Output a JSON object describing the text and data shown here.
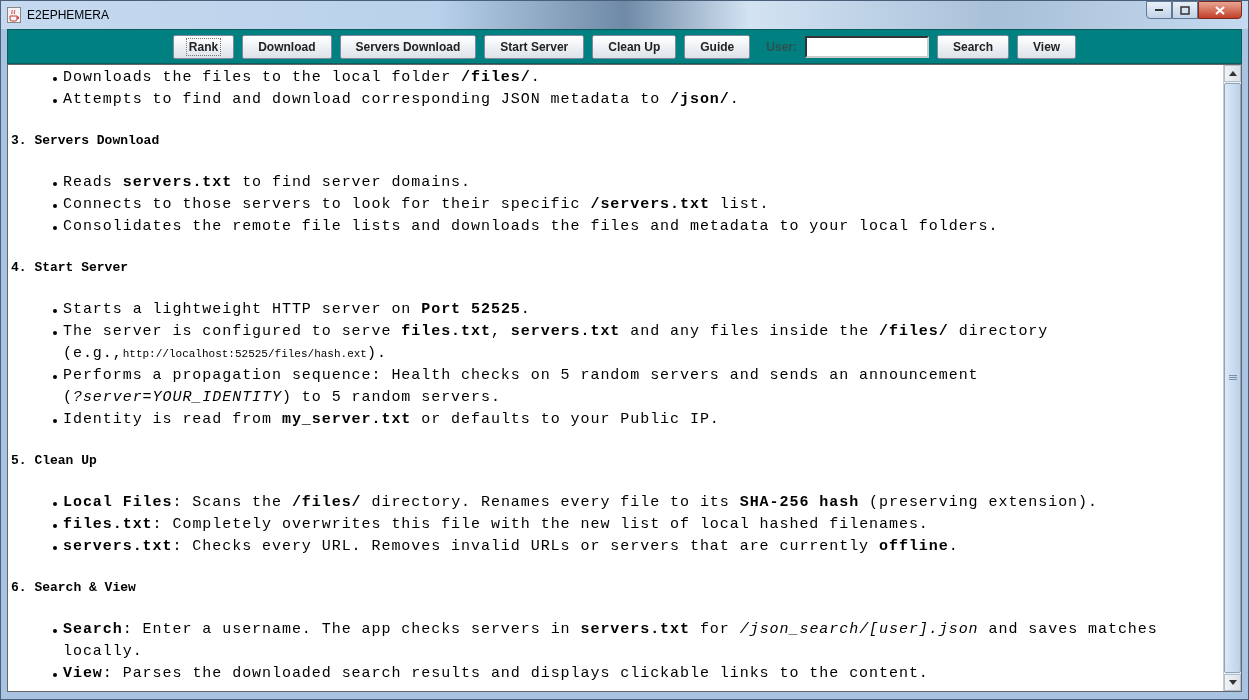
{
  "window": {
    "title": "E2EPHEMERA"
  },
  "toolbar": {
    "buttons_left": [
      {
        "label": "Rank",
        "focused": true
      },
      {
        "label": "Download",
        "focused": false
      },
      {
        "label": "Servers Download",
        "focused": false
      },
      {
        "label": "Start Server",
        "focused": false
      },
      {
        "label": "Clean Up",
        "focused": false
      },
      {
        "label": "Guide",
        "focused": false
      }
    ],
    "user_label": "User:",
    "buttons_right": [
      {
        "label": "Search",
        "focused": false
      },
      {
        "label": "View",
        "focused": false
      }
    ]
  },
  "sections": [
    {
      "items": [
        {
          "text": "Downloads the files to the local folder **/files/**."
        },
        {
          "text": "Attempts to find and download corresponding JSON metadata to **/json/**."
        }
      ]
    },
    {
      "heading": "3. Servers Download",
      "items": [
        {
          "text": "Reads **servers.txt** to find server domains."
        },
        {
          "text": "Connects to those servers to look for their specific **/servers.txt** list."
        },
        {
          "text": "Consolidates the remote file lists and downloads the files and metadata to your local folders."
        }
      ]
    },
    {
      "heading": "4. Start Server",
      "items": [
        {
          "text": "Starts a lightweight HTTP server on **Port 52525**."
        },
        {
          "text": "The server is configured to serve **files.txt**, **servers.txt** and any files inside the **/files/** directory (e.g.,",
          "small": "http://localhost:52525/files/hash.ext",
          "after": ")."
        },
        {
          "lines": [
            "Performs a propagation sequence: Health checks on 5 random servers and sends an announcement",
            "(*?server=YOUR_IDENTITY*) to 5 random servers."
          ]
        },
        {
          "text": "Identity is read from **my_server.txt** or defaults to your Public IP."
        }
      ]
    },
    {
      "heading": "5. Clean Up",
      "items": [
        {
          "text": "**Local Files**: Scans the **/files/** directory. Renames every file to its **SHA-256 hash** (preserving extension)."
        },
        {
          "text": "**files.txt**: Completely overwrites this file with the new list of local hashed filenames."
        },
        {
          "text": "**servers.txt**: Checks every URL. Removes invalid URLs or servers that are currently **offline**."
        }
      ]
    },
    {
      "heading": "6. Search & View",
      "items": [
        {
          "text": "**Search**: Enter a username. The app checks servers in **servers.txt** for */json_search/[user].json* and saves matches locally."
        },
        {
          "text": "**View**: Parses the downloaded search results and displays clickable links to the content."
        }
      ]
    }
  ]
}
